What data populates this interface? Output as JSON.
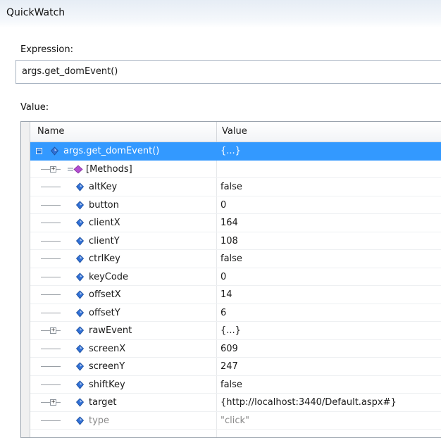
{
  "window": {
    "title": "QuickWatch"
  },
  "expression": {
    "label": "Expression:",
    "value": "args.get_domEvent()"
  },
  "value_section": {
    "label": "Value:"
  },
  "grid": {
    "columns": {
      "name": "Name",
      "value": "Value"
    },
    "rows": [
      {
        "name": "args.get_domEvent()",
        "value": "{...}",
        "selected": true,
        "expandable": true,
        "icon": "property-icon"
      },
      {
        "name": "[Methods]",
        "value": "",
        "expandable": true,
        "icon": "methods-icon"
      },
      {
        "name": "altKey",
        "value": "false",
        "icon": "property-icon"
      },
      {
        "name": "button",
        "value": "0",
        "icon": "property-icon"
      },
      {
        "name": "clientX",
        "value": "164",
        "icon": "property-icon"
      },
      {
        "name": "clientY",
        "value": "108",
        "icon": "property-icon"
      },
      {
        "name": "ctrlKey",
        "value": "false",
        "icon": "property-icon"
      },
      {
        "name": "keyCode",
        "value": "0",
        "icon": "property-icon"
      },
      {
        "name": "offsetX",
        "value": "14",
        "icon": "property-icon"
      },
      {
        "name": "offsetY",
        "value": "6",
        "icon": "property-icon"
      },
      {
        "name": "rawEvent",
        "value": "{...}",
        "expandable": true,
        "icon": "property-icon"
      },
      {
        "name": "screenX",
        "value": "609",
        "icon": "property-icon"
      },
      {
        "name": "screenY",
        "value": "247",
        "icon": "property-icon"
      },
      {
        "name": "shiftKey",
        "value": "false",
        "icon": "property-icon"
      },
      {
        "name": "target",
        "value": "{http://localhost:3440/Default.aspx#}",
        "expandable": true,
        "icon": "property-icon"
      },
      {
        "name": "type",
        "value": "\"click\"",
        "icon": "property-icon",
        "dim": true
      }
    ]
  },
  "colors": {
    "selection": "#3399ff",
    "property_icon": "#2f6fd6",
    "methods_icon": "#b34fd0"
  }
}
